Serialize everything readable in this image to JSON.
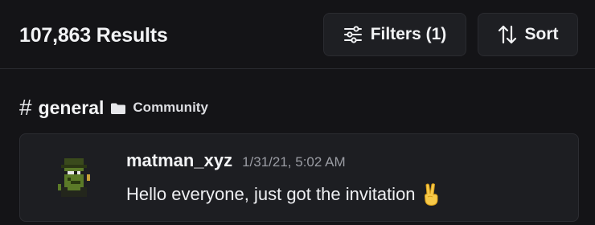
{
  "header": {
    "results_count": "107,863 Results",
    "filters_label": "Filters (1)",
    "filters_icon": "sliders-icon",
    "sort_label": "Sort",
    "sort_icon": "sort-arrows-icon"
  },
  "channel": {
    "hash_symbol": "#",
    "name": "general",
    "category_icon": "folder-icon",
    "category": "Community"
  },
  "message": {
    "avatar_icon": "pixel-avatar",
    "author": "matman_xyz",
    "timestamp": "1/31/21, 5:02 AM",
    "text": "Hello everyone, just got the invitation",
    "emoji": "victory-hand-emoji"
  },
  "colors": {
    "background": "#141417",
    "card": "#1d1e22",
    "button": "#1e1f23",
    "muted_text": "#9a9ca3"
  }
}
